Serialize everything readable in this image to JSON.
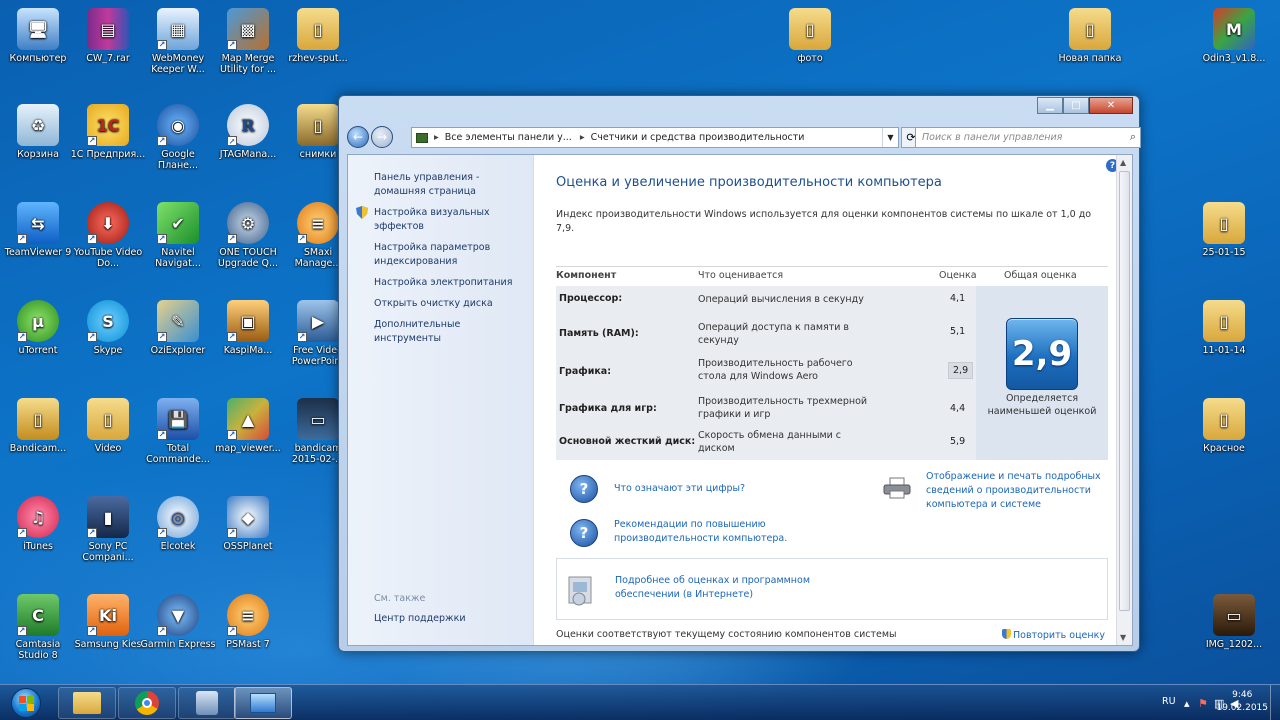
{
  "desktop_icons": [
    {
      "label": "Компьютер",
      "icon": "computer-icon"
    },
    {
      "label": "CW_7.rar",
      "icon": "winrar-archive-icon"
    },
    {
      "label": "WebMoney Keeper W...",
      "icon": "webmoney-icon"
    },
    {
      "label": "Map Merge Utility for ...",
      "icon": "map-merge-icon"
    },
    {
      "label": "rzhev-sput...",
      "icon": "folder-icon"
    },
    {
      "label": "фото",
      "icon": "folder-icon"
    },
    {
      "label": "Новая папка",
      "icon": "folder-icon"
    },
    {
      "label": "Odin3_v1.8...",
      "icon": "odin-icon"
    },
    {
      "label": "Корзина",
      "icon": "recycle-bin-icon"
    },
    {
      "label": "1С Предприя...",
      "icon": "1c-icon"
    },
    {
      "label": "Google Плане...",
      "icon": "google-earth-icon"
    },
    {
      "label": "JTAGMana...",
      "icon": "jtag-icon"
    },
    {
      "label": "снимки",
      "icon": "folder-icon"
    },
    {
      "label": "TeamViewer 9",
      "icon": "teamviewer-icon"
    },
    {
      "label": "YouTube Video Do...",
      "icon": "youtube-downloader-icon"
    },
    {
      "label": "Navitel Navigat...",
      "icon": "navitel-icon"
    },
    {
      "label": "ONE TOUCH Upgrade Q...",
      "icon": "one-touch-icon"
    },
    {
      "label": "SMaxi Manage...",
      "icon": "smaxi-icon"
    },
    {
      "label": "25-01-15",
      "icon": "folder-icon"
    },
    {
      "label": "uTorrent",
      "icon": "utorrent-icon"
    },
    {
      "label": "Skype",
      "icon": "skype-icon"
    },
    {
      "label": "OziExplorer",
      "icon": "ozi-icon"
    },
    {
      "label": "KaspiMa...",
      "icon": "kaspi-icon"
    },
    {
      "label": "Free Video PowerPoint",
      "icon": "ppt-video-icon"
    },
    {
      "label": "11-01-14",
      "icon": "folder-icon"
    },
    {
      "label": "Bandicam...",
      "icon": "folder-icon"
    },
    {
      "label": "Video",
      "icon": "folder-icon"
    },
    {
      "label": "Total Commande...",
      "icon": "total-commander-icon"
    },
    {
      "label": "map_viewer...",
      "icon": "map-viewer-icon"
    },
    {
      "label": "bandicam 2015-02-...",
      "icon": "video-thumb-icon"
    },
    {
      "label": "Красное",
      "icon": "folder-icon"
    },
    {
      "label": "iTunes",
      "icon": "itunes-icon"
    },
    {
      "label": "Sony PC Compani...",
      "icon": "sony-pc-icon"
    },
    {
      "label": "Elcotek",
      "icon": "elcotek-icon"
    },
    {
      "label": "OSSPlanet",
      "icon": "ossplanet-icon"
    },
    {
      "label": "Camtasia Studio 8",
      "icon": "camtasia-icon"
    },
    {
      "label": "Samsung Kies",
      "icon": "kies-icon"
    },
    {
      "label": "Garmin Express",
      "icon": "garmin-icon"
    },
    {
      "label": "PSMast 7",
      "icon": "psmast-icon"
    },
    {
      "label": "IMG_1202...",
      "icon": "image-thumb-icon"
    }
  ],
  "window": {
    "address_segments": [
      "Все элементы панели у...",
      "Счетчики и средства производительности"
    ],
    "search_placeholder": "Поиск в панели управления",
    "left_links": [
      "Панель управления - домашняя страница",
      "Настройка визуальных эффектов",
      "Настройка параметров индексирования",
      "Настройка электропитания",
      "Открыть очистку диска",
      "Дополнительные инструменты"
    ],
    "see_also": "См. также",
    "support_link": "Центр поддержки",
    "title": "Оценка и увеличение производительности компьютера",
    "description": "Индекс производительности Windows используется для оценки компонентов системы по шкале от 1,0 до 7,9.",
    "table_headers": {
      "component": "Компонент",
      "what": "Что оценивается",
      "score": "Оценка",
      "overall": "Общая оценка"
    },
    "rows": [
      {
        "component": "Процессор:",
        "what": "Операций вычисления в секунду",
        "score": "4,1"
      },
      {
        "component": "Память (RAM):",
        "what": "Операций доступа к памяти в секунду",
        "score": "5,1"
      },
      {
        "component": "Графика:",
        "what": "Производительность рабочего стола для Windows Aero",
        "score": "2,9"
      },
      {
        "component": "Графика для игр:",
        "what": "Производительность трехмерной графики и игр",
        "score": "4,4"
      },
      {
        "component": "Основной жесткий диск:",
        "what": "Скорость обмена данными с диском",
        "score": "5,9"
      }
    ],
    "overall_score": "2,9",
    "overall_caption": "Определяется наименьшей оценкой",
    "link_what_means": "Что означают эти цифры?",
    "link_recommendations": "Рекомендации по повышению производительности компьютера.",
    "link_print": "Отображение и печать подробных сведений о производительности компьютера и системе",
    "link_more_info": "Подробнее об оценках и программном обеспечении (в Интернете)",
    "footer_text": "Оценки соответствуют текущему состоянию компонентов системы",
    "repeat_link": "Повторить оценку"
  },
  "taskbar": {
    "lang": "RU",
    "time": "9:46",
    "date": "19.02.2015"
  },
  "colors": {
    "accent": "#1b66b8",
    "heading": "#1e4f8e",
    "badge": "#1d6fc0"
  }
}
